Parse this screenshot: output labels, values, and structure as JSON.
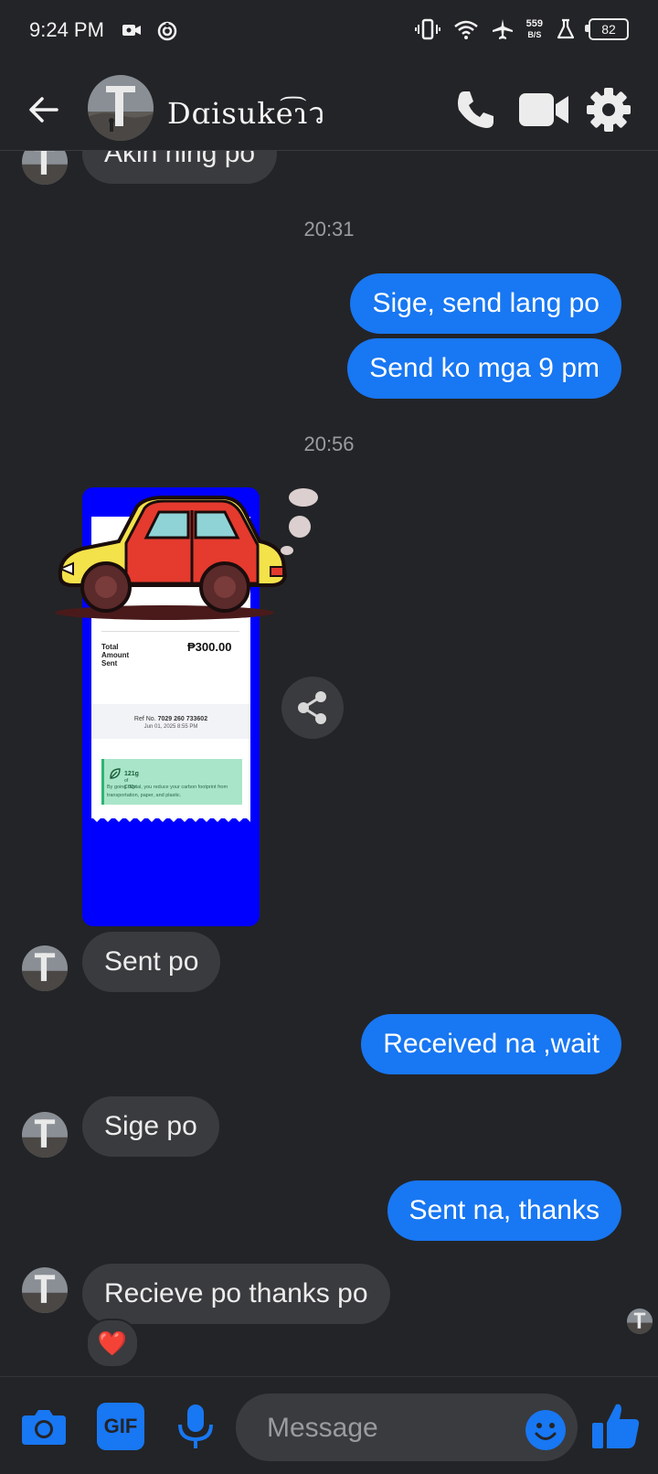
{
  "status_bar": {
    "time": "9:24 PM",
    "net_speed_value": "559",
    "net_speed_unit": "B/S",
    "battery": "82"
  },
  "header": {
    "contact_name": "Dɑisuke͡ɿว"
  },
  "messages": {
    "partial_in": "Akin ning po",
    "ts1": "20:31",
    "out1": "Sige, send lang po",
    "out2": "Send ko mga 9 pm",
    "ts2": "20:56",
    "in1": "Sent po",
    "out3": "Received na ,wait",
    "in2": "Sige po",
    "out4": "Sent na, thanks",
    "in3": "Recieve po thanks po",
    "reaction": "❤️"
  },
  "receipt": {
    "total_label": "Total Amount Sent",
    "total_value": "₱300.00",
    "ref_label": "Ref No.",
    "ref_no": "7029 260 733602",
    "date": "Jun 01, 2025 8:55 PM",
    "carbon_value": "121g",
    "carbon_unit": "of CO2e",
    "carbon_text": "By going digital, you reduce your carbon footprint from transportation, paper, and plastic."
  },
  "composer": {
    "placeholder": "Message",
    "gif_label": "GIF"
  },
  "colors": {
    "background": "#232427",
    "incoming_bubble": "#3a3b3e",
    "outgoing_bubble": "#1877f2",
    "accent": "#1877f2"
  },
  "icons": [
    "back-arrow-icon",
    "phone-icon",
    "video-camera-icon",
    "gear-icon",
    "share-icon",
    "camera-icon",
    "gif-icon",
    "microphone-icon",
    "emoji-icon",
    "thumbs-up-icon"
  ]
}
